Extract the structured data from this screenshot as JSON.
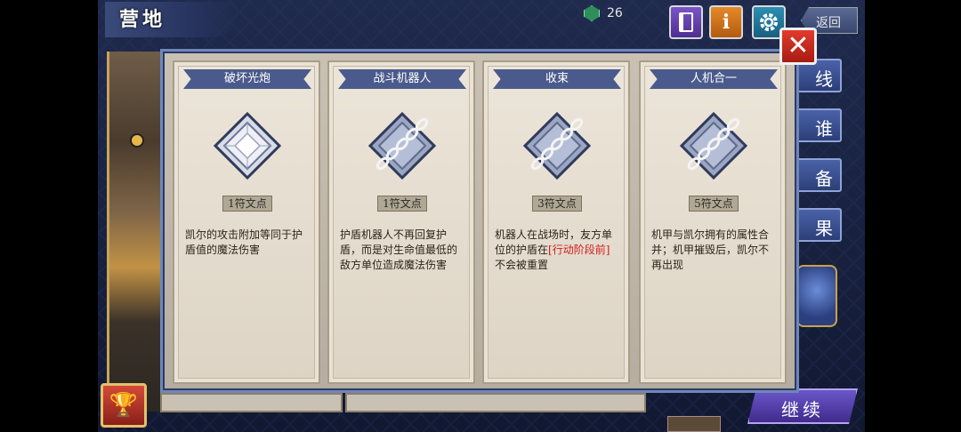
{
  "header": {
    "title": "营地",
    "gem_count": "26",
    "back_label": "返回"
  },
  "top_buttons": {
    "book_icon": "book-icon",
    "info_label": "i",
    "gear_icon": "gear-icon"
  },
  "side_buttons": [
    "线",
    "谁",
    "备",
    "果"
  ],
  "continue_label": "继续",
  "close_label": "✕",
  "cards": [
    {
      "title": "破坏光炮",
      "cost": "1符文点",
      "desc": "凯尔的攻击附加等同于护盾值的魔法伤害",
      "icon": "plain-gem"
    },
    {
      "title": "战斗机器人",
      "cost": "1符文点",
      "desc": "护盾机器人不再回复护盾，而是对生命值最低的敌方单位造成魔法伤害",
      "icon": "chained-gem"
    },
    {
      "title": "收束",
      "cost": "3符文点",
      "desc_before": "机器人在战场时，友方单位的护盾在",
      "desc_highlight": "[行动阶段前]",
      "desc_after": "不会被重置",
      "icon": "chained-gem"
    },
    {
      "title": "人机合一",
      "cost": "5符文点",
      "desc": "机甲与凯尔拥有的属性合并；机甲摧毁后，凯尔不再出现",
      "icon": "chained-gem"
    }
  ],
  "colors": {
    "dialog_border": "#6f87b8",
    "title_bar": "#4a5a8c",
    "highlight": "#d21d1d",
    "close": "#e23a2d"
  }
}
